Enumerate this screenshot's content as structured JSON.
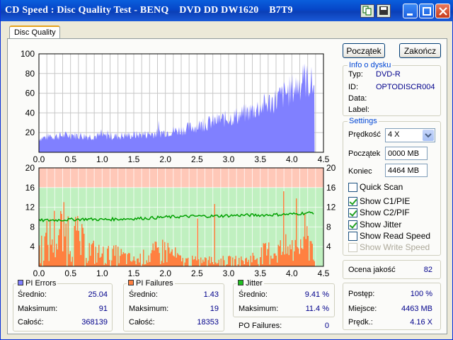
{
  "window": {
    "title": "CD Speed : Disc Quality Test - BENQ    DVD DD DW1620    B7T9"
  },
  "tabs": [
    {
      "label": "Disc Quality"
    }
  ],
  "buttons": {
    "start": "Początek",
    "exit": "Zakończ"
  },
  "disc_info": {
    "title": "Info o dysku",
    "rows": [
      {
        "label": "Typ:",
        "value": "DVD-R"
      },
      {
        "label": "ID:",
        "value": "OPTODISCR004"
      },
      {
        "label": "Data:",
        "value": ""
      },
      {
        "label": "Label:",
        "value": ""
      }
    ]
  },
  "settings": {
    "title": "Settings",
    "speed_label": "Prędkość",
    "speed_value": "4 X",
    "start_label": "Początek",
    "start_value": "0000 MB",
    "end_label": "Koniec",
    "end_value": "4464 MB",
    "checkboxes": [
      {
        "label": "Quick Scan",
        "checked": false,
        "disabled": false
      },
      {
        "label": "Show C1/PIE",
        "checked": true,
        "disabled": false
      },
      {
        "label": "Show C2/PIF",
        "checked": true,
        "disabled": false
      },
      {
        "label": "Show Jitter",
        "checked": true,
        "disabled": false
      },
      {
        "label": "Show Read Speed",
        "checked": false,
        "disabled": false
      },
      {
        "label": "Show Write Speed",
        "checked": false,
        "disabled": true
      }
    ]
  },
  "quality": {
    "label": "Ocena jakość",
    "value": "82"
  },
  "progress": {
    "rows": [
      {
        "label": "Postęp:",
        "value": "100 %"
      },
      {
        "label": "Miejsce:",
        "value": "4463 MB"
      },
      {
        "label": "Prędk.:",
        "value": "4.16 X"
      }
    ]
  },
  "stats": {
    "pi_errors": {
      "title": "PI Errors",
      "color": "#8080ff",
      "rows": [
        {
          "label": "Średnio:",
          "value": "25.04"
        },
        {
          "label": "Maksimum:",
          "value": "91"
        },
        {
          "label": "Całość:",
          "value": "368139"
        }
      ]
    },
    "pi_failures": {
      "title": "PI Failures",
      "color": "#ff8040",
      "rows": [
        {
          "label": "Średnio:",
          "value": "1.43"
        },
        {
          "label": "Maksimum:",
          "value": "19"
        },
        {
          "label": "Całość:",
          "value": "18353"
        }
      ]
    },
    "jitter": {
      "title": "Jitter",
      "color": "#20c020",
      "rows": [
        {
          "label": "Średnio:",
          "value": "9.41 %"
        },
        {
          "label": "Maksimum:",
          "value": "11.4 %"
        }
      ]
    },
    "po_failures": {
      "label": "PO Failures:",
      "value": "0"
    }
  },
  "chart_data": [
    {
      "type": "area",
      "series": [
        {
          "values_color": "#8080ff"
        }
      ],
      "x": [
        0.0,
        0.25,
        0.5,
        0.75,
        1.0,
        1.25,
        1.5,
        1.75,
        2.0,
        2.25,
        2.5,
        2.75,
        3.0,
        3.25,
        3.5,
        3.75,
        4.0,
        4.2,
        4.36
      ],
      "y": [
        14,
        16,
        17,
        16,
        16,
        16,
        17,
        18,
        20,
        22,
        26,
        30,
        34,
        38,
        45,
        52,
        62,
        72,
        66
      ],
      "xlim": [
        0,
        4.5
      ],
      "ylim": [
        0,
        100
      ],
      "yticks": [
        20,
        40,
        60,
        80,
        100
      ],
      "xticks": [
        "0.0",
        "0.5",
        "1.0",
        "1.5",
        "2.0",
        "2.5",
        "3.0",
        "3.5",
        "4.0",
        "4.5"
      ],
      "grid": true
    },
    {
      "type": "bar",
      "pif_color": "#ff8040",
      "jitter_color": "#00a000",
      "x": [
        0.0,
        0.25,
        0.5,
        0.75,
        1.0,
        1.25,
        1.5,
        1.75,
        2.0,
        2.25,
        2.5,
        2.75,
        3.0,
        3.25,
        3.5,
        3.75,
        4.0,
        4.2,
        4.36
      ],
      "pif": [
        3,
        6,
        6,
        3,
        2,
        2,
        1,
        2,
        3,
        1,
        1,
        1,
        1,
        1,
        2,
        3,
        3,
        5,
        4
      ],
      "jitter": [
        9.3,
        9.4,
        9.5,
        9.6,
        9.5,
        9.6,
        9.7,
        9.8,
        10.0,
        10.1,
        10.2,
        10.2,
        10.3,
        10.4,
        10.4,
        10.5,
        10.6,
        10.8,
        10.9
      ],
      "xlim": [
        0,
        4.5
      ],
      "ylim": [
        0,
        20
      ],
      "yticks": [
        4,
        8,
        12,
        16,
        20
      ],
      "xticks": [
        "0.0",
        "0.5",
        "1.0",
        "1.5",
        "2.0",
        "2.5",
        "3.0",
        "3.5",
        "4.0",
        "4.5"
      ],
      "bands": [
        {
          "from": 16,
          "to": 20,
          "color": "#ffc8b8"
        },
        {
          "from": 0,
          "to": 16,
          "color": "#c0f0c0"
        }
      ]
    }
  ]
}
